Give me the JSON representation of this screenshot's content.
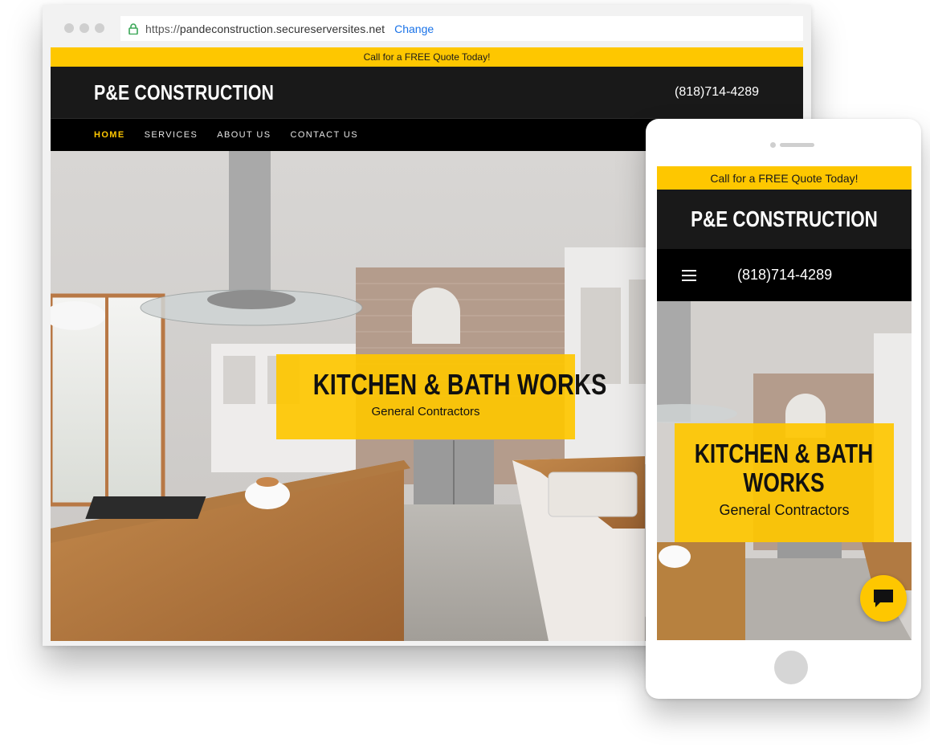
{
  "browser": {
    "url_scheme": "https://",
    "url_host": "pandeconstruction.secureserversites.net",
    "change_label": "Change"
  },
  "site": {
    "promo": "Call for a FREE Quote Today!",
    "logo": "P&E CONSTRUCTION",
    "phone": "(818)714-4289",
    "nav": [
      {
        "label": "HOME",
        "active": true
      },
      {
        "label": "SERVICES",
        "active": false
      },
      {
        "label": "ABOUT US",
        "active": false
      },
      {
        "label": "CONTACT US",
        "active": false
      }
    ],
    "hero": {
      "title": "KITCHEN & BATH WORKS",
      "subtitle": "General Contractors",
      "image": "kitchen-interior-photo"
    }
  },
  "mobile": {
    "promo": "Call for a FREE Quote Today!",
    "logo": "P&E CONSTRUCTION",
    "phone": "(818)714-4289",
    "menu_icon": "hamburger-icon",
    "hero": {
      "title": "KITCHEN & BATH WORKS",
      "subtitle": "General Contractors"
    },
    "chat_icon": "chat-bubble-icon"
  },
  "colors": {
    "accent": "#fec700",
    "header_bg": "#191919",
    "nav_bg": "#000000",
    "link": "#1a73e8"
  }
}
